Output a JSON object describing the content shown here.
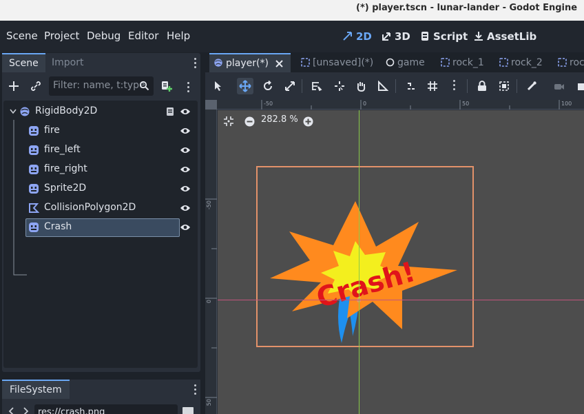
{
  "window": {
    "title": "(*) player.tscn - lunar-lander - Godot Engine"
  },
  "menu": [
    "Scene",
    "Project",
    "Debug",
    "Editor",
    "Help"
  ],
  "workspaces": [
    {
      "label": "2D",
      "icon": "2d-icon",
      "active": true
    },
    {
      "label": "3D",
      "icon": "3d-icon",
      "active": false
    },
    {
      "label": "Script",
      "icon": "script-icon",
      "active": false
    },
    {
      "label": "AssetLib",
      "icon": "assetlib-icon",
      "active": false
    }
  ],
  "scene_dock": {
    "tabs": [
      "Scene",
      "Import"
    ],
    "filter_placeholder": "Filter: name, t:type",
    "nodes": [
      {
        "label": "RigidBody2D",
        "icon": "rigidbody2d-icon",
        "depth": 0,
        "has_script": true
      },
      {
        "label": "fire",
        "icon": "animated-sprite-icon",
        "depth": 1
      },
      {
        "label": "fire_left",
        "icon": "animated-sprite-icon",
        "depth": 1
      },
      {
        "label": "fire_right",
        "icon": "animated-sprite-icon",
        "depth": 1
      },
      {
        "label": "Sprite2D",
        "icon": "sprite2d-icon",
        "depth": 1
      },
      {
        "label": "CollisionPolygon2D",
        "icon": "collision-polygon-icon",
        "depth": 1
      },
      {
        "label": "Crash",
        "icon": "sprite2d-icon",
        "depth": 1,
        "selected": true
      }
    ]
  },
  "filesystem_dock": {
    "tab": "FileSystem",
    "path": "res://crash.png"
  },
  "scene_tabs": [
    {
      "label": "player(*)",
      "icon": "rigidbody2d-icon",
      "active": true,
      "closable": true
    },
    {
      "label": "[unsaved](*)",
      "icon": "node2d-icon",
      "active": false
    },
    {
      "label": "game",
      "icon": "node-icon",
      "active": false
    },
    {
      "label": "rock_1",
      "icon": "node2d-icon",
      "active": false
    },
    {
      "label": "rock_2",
      "icon": "node2d-icon",
      "active": false
    },
    {
      "label": "roc",
      "icon": "node2d-icon",
      "active": false
    }
  ],
  "viewport": {
    "zoom": "282.8 %",
    "ruler_top_labels": [
      "-50",
      "0",
      "50",
      "100"
    ],
    "ruler_left_labels": [
      "-50",
      "0",
      "50"
    ],
    "sprite_text": "Crash!"
  },
  "colors": {
    "accent": "#6aa7f5",
    "frame": "#e3926a",
    "y_axis": "#89c94a",
    "x_axis": "#c2557d",
    "node_icon": "#8da5f3",
    "explosion_orange": "#ff8a1e",
    "explosion_yellow": "#f3ef1e",
    "crash_text": "#e0141a",
    "flame_blue": "#1e90ef"
  }
}
